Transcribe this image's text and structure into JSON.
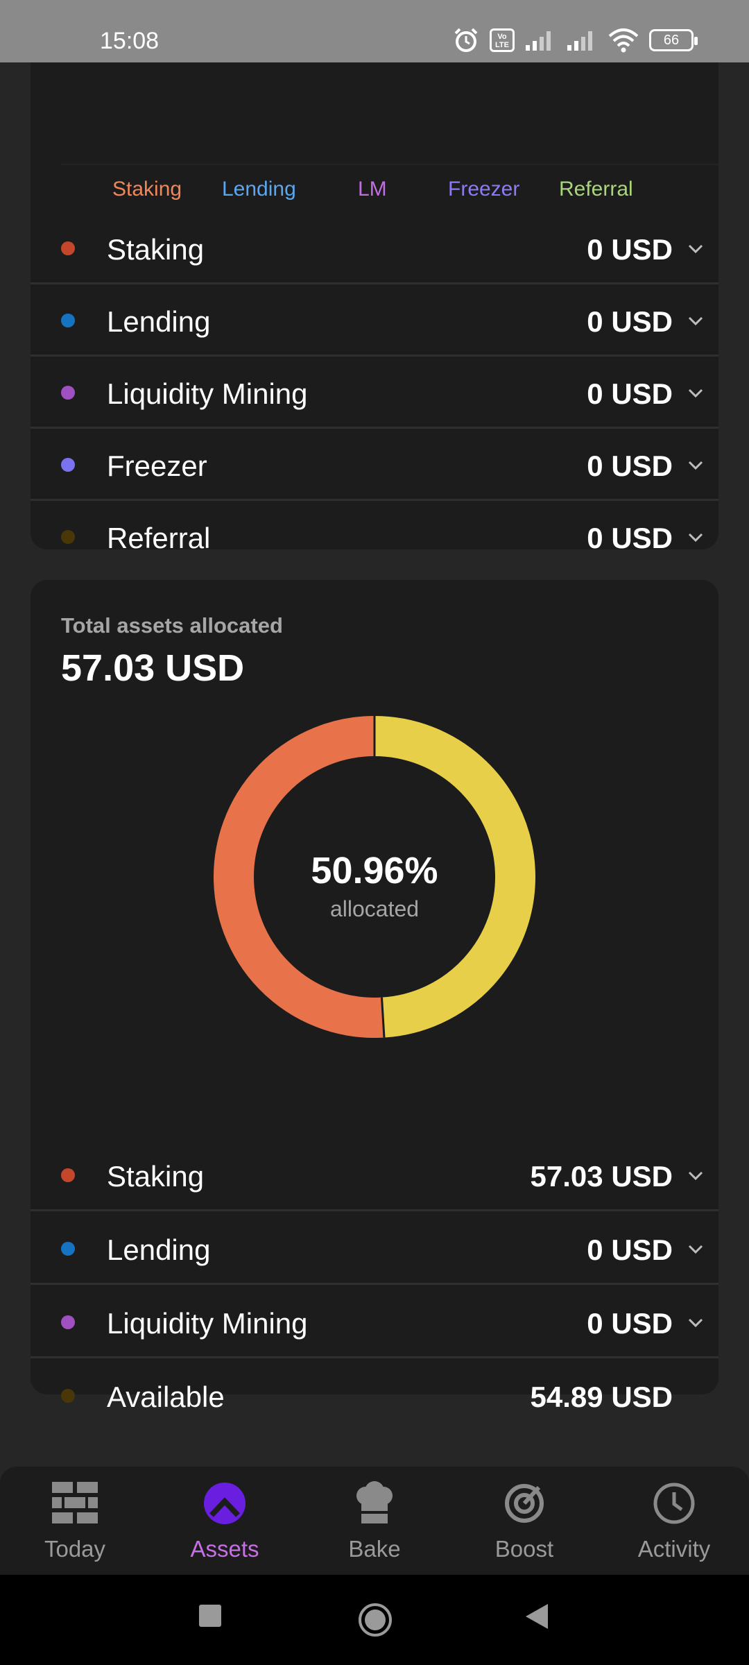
{
  "status_bar": {
    "time": "15:08",
    "volte_label": "Vo LTE",
    "battery": "66",
    "icons": [
      "alarm-icon",
      "volte-icon",
      "signal-icon",
      "signal-icon",
      "wifi-icon",
      "battery-icon"
    ]
  },
  "top_card": {
    "tabs": [
      {
        "label": "Staking",
        "color": "#f0875a"
      },
      {
        "label": "Lending",
        "color": "#5aa7f0"
      },
      {
        "label": "LM",
        "color": "#c06ee0"
      },
      {
        "label": "Freezer",
        "color": "#8a7cf5"
      },
      {
        "label": "Referral",
        "color": "#a9d67a"
      }
    ],
    "rows": [
      {
        "label": "Staking",
        "value": "0 USD",
        "dot_color": "#c4472b"
      },
      {
        "label": "Lending",
        "value": "0 USD",
        "dot_color": "#1673c2"
      },
      {
        "label": "Liquidity Mining",
        "value": "0 USD",
        "dot_color": "#a050c0"
      },
      {
        "label": "Freezer",
        "value": "0 USD",
        "dot_color": "#7b72f0"
      },
      {
        "label": "Referral",
        "value": "0 USD",
        "dot_color": "#4a3708"
      }
    ]
  },
  "allocation_card": {
    "title": "Total assets allocated",
    "total": "57.03 USD",
    "percent_text": "50.96%",
    "percent_sub": "allocated",
    "donut": {
      "allocated_fraction": 0.5096,
      "allocated_color": "#e8734a",
      "available_color": "#e8cf4a"
    },
    "rows": [
      {
        "label": "Staking",
        "value": "57.03 USD",
        "dot_color": "#c4472b",
        "expandable": true
      },
      {
        "label": "Lending",
        "value": "0 USD",
        "dot_color": "#1673c2",
        "expandable": true
      },
      {
        "label": "Liquidity Mining",
        "value": "0 USD",
        "dot_color": "#a050c0",
        "expandable": true
      },
      {
        "label": "Available",
        "value": "54.89 USD",
        "dot_color": "#4a3708",
        "expandable": false
      }
    ]
  },
  "bottom_nav": {
    "items": [
      {
        "label": "Today",
        "icon": "bricks-icon",
        "active": false
      },
      {
        "label": "Assets",
        "icon": "assets-icon",
        "active": true
      },
      {
        "label": "Bake",
        "icon": "chef-hat-icon",
        "active": false
      },
      {
        "label": "Boost",
        "icon": "boost-icon",
        "active": false
      },
      {
        "label": "Activity",
        "icon": "clock-icon",
        "active": false
      }
    ],
    "active_color": "#c86ee6",
    "inactive_color": "#9a9a9a"
  },
  "system_nav": [
    "recents-icon",
    "home-icon",
    "back-icon"
  ]
}
